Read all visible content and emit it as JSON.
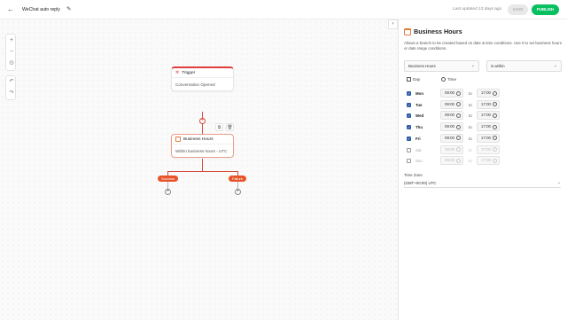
{
  "header": {
    "back_icon": "arrow-left-icon",
    "title": "WeChat auto reply",
    "edit_icon": "pencil-icon",
    "last_updated": "Last updated 13 days ago",
    "save_label": "SAVE",
    "publish_label": "PUBLISH",
    "publish_color": "#07c160"
  },
  "canvas": {
    "zoom_in": "+",
    "zoom_out": "−",
    "fit": "⊙",
    "undo": "↶",
    "redo": "↷",
    "trigger_node": {
      "title": "Trigger",
      "body": "Conversation Opened"
    },
    "business_node": {
      "title": "Business Hours",
      "body": "Within business hours - UTC"
    },
    "branches": {
      "success": "Success",
      "failure": "Failure"
    },
    "accent_color": "#e8542a"
  },
  "panel": {
    "collapse_icon": "chevron-right-icon",
    "title": "Business Hours",
    "description": "Allows a branch to be created based on date & time conditions. Use it to set business hours or date range conditions.",
    "condition_field": "Business Hours",
    "condition_operator": "is within",
    "col_day": "Day",
    "col_time": "Time",
    "to_label": "to",
    "days": [
      {
        "name": "Mon",
        "checked": true,
        "from": "09:00",
        "to": "17:00"
      },
      {
        "name": "Tue",
        "checked": true,
        "from": "09:00",
        "to": "17:00"
      },
      {
        "name": "Wed",
        "checked": true,
        "from": "09:00",
        "to": "17:00"
      },
      {
        "name": "Thu",
        "checked": true,
        "from": "09:00",
        "to": "17:00"
      },
      {
        "name": "Fri",
        "checked": true,
        "from": "09:00",
        "to": "17:00"
      },
      {
        "name": "Sat",
        "checked": false,
        "from": "09:00",
        "to": "17:00"
      },
      {
        "name": "Sun",
        "checked": false,
        "from": "09:00",
        "to": "17:00"
      }
    ],
    "timezone_label": "Time Zone",
    "timezone_value": "(GMT+00:00) UTC"
  }
}
